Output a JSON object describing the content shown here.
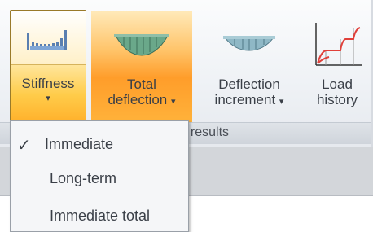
{
  "ribbon": {
    "group_label": "f results",
    "buttons": [
      {
        "label": "Stiffness",
        "caret": "▾",
        "icon": "stiffness-icon"
      },
      {
        "label_line1": "Total",
        "label_line2": "deflection",
        "caret": "▾",
        "icon": "total-deflection-icon"
      },
      {
        "label_line1": "Deflection",
        "label_line2": "increment",
        "caret": "▾",
        "icon": "deflection-increment-icon"
      },
      {
        "label_line1": "Load",
        "label_line2": "history",
        "icon": "load-history-icon"
      }
    ]
  },
  "menu": {
    "items": [
      {
        "label": "Immediate",
        "checked": true,
        "check_glyph": "✓"
      },
      {
        "label": "Long-term",
        "checked": false
      },
      {
        "label": "Immediate total",
        "checked": false
      }
    ]
  },
  "colors": {
    "selected_accent": "#ffb02a",
    "hover_accent": "#ff9d2a",
    "ribbon_bg": "#eef1f5",
    "icon_blue": "#4d8bc8",
    "icon_green": "#6aa88a",
    "icon_red": "#e0403a"
  }
}
